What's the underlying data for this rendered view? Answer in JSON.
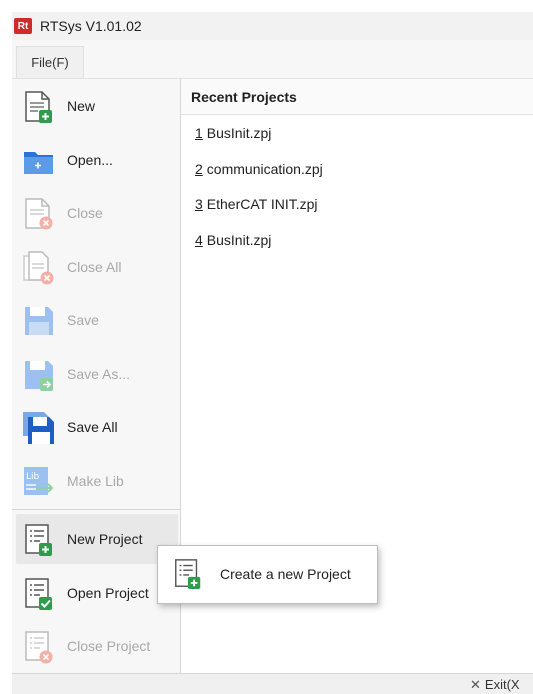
{
  "window": {
    "title": "RTSys V1.01.02",
    "logo_text": "Rt"
  },
  "menubar": {
    "file_label": "File(F)"
  },
  "file_menu": {
    "items": [
      {
        "label": "New",
        "icon": "new-file-icon",
        "enabled": true
      },
      {
        "label": "Open...",
        "icon": "folder-icon",
        "enabled": true
      },
      {
        "label": "Close",
        "icon": "close-file-icon",
        "enabled": false
      },
      {
        "label": "Close All",
        "icon": "close-all-icon",
        "enabled": false
      },
      {
        "label": "Save",
        "icon": "save-icon",
        "enabled": false
      },
      {
        "label": "Save As...",
        "icon": "save-as-icon",
        "enabled": false
      },
      {
        "label": "Save All",
        "icon": "save-all-icon",
        "enabled": true
      },
      {
        "label": "Make Lib",
        "icon": "make-lib-icon",
        "enabled": false
      },
      {
        "label": "New Project",
        "icon": "new-project-icon",
        "enabled": true
      },
      {
        "label": "Open Project",
        "icon": "open-project-icon",
        "enabled": true
      },
      {
        "label": "Close Project",
        "icon": "close-project-icon",
        "enabled": false
      }
    ]
  },
  "recent": {
    "header": "Recent Projects",
    "items": [
      {
        "num": "1",
        "name": "BusInit.zpj"
      },
      {
        "num": "2",
        "name": "communication.zpj"
      },
      {
        "num": "3",
        "name": "EtherCAT INIT.zpj"
      },
      {
        "num": "4",
        "name": "BusInit.zpj"
      }
    ]
  },
  "tooltip": {
    "text": "Create a new Project",
    "icon": "new-project-icon"
  },
  "statusbar": {
    "exit_label": "Exit(X"
  },
  "colors": {
    "accent_blue": "#2b73d6",
    "accent_green": "#2e9d4a",
    "disabled": "#a8a8a8",
    "close_red": "#e56b5a"
  }
}
